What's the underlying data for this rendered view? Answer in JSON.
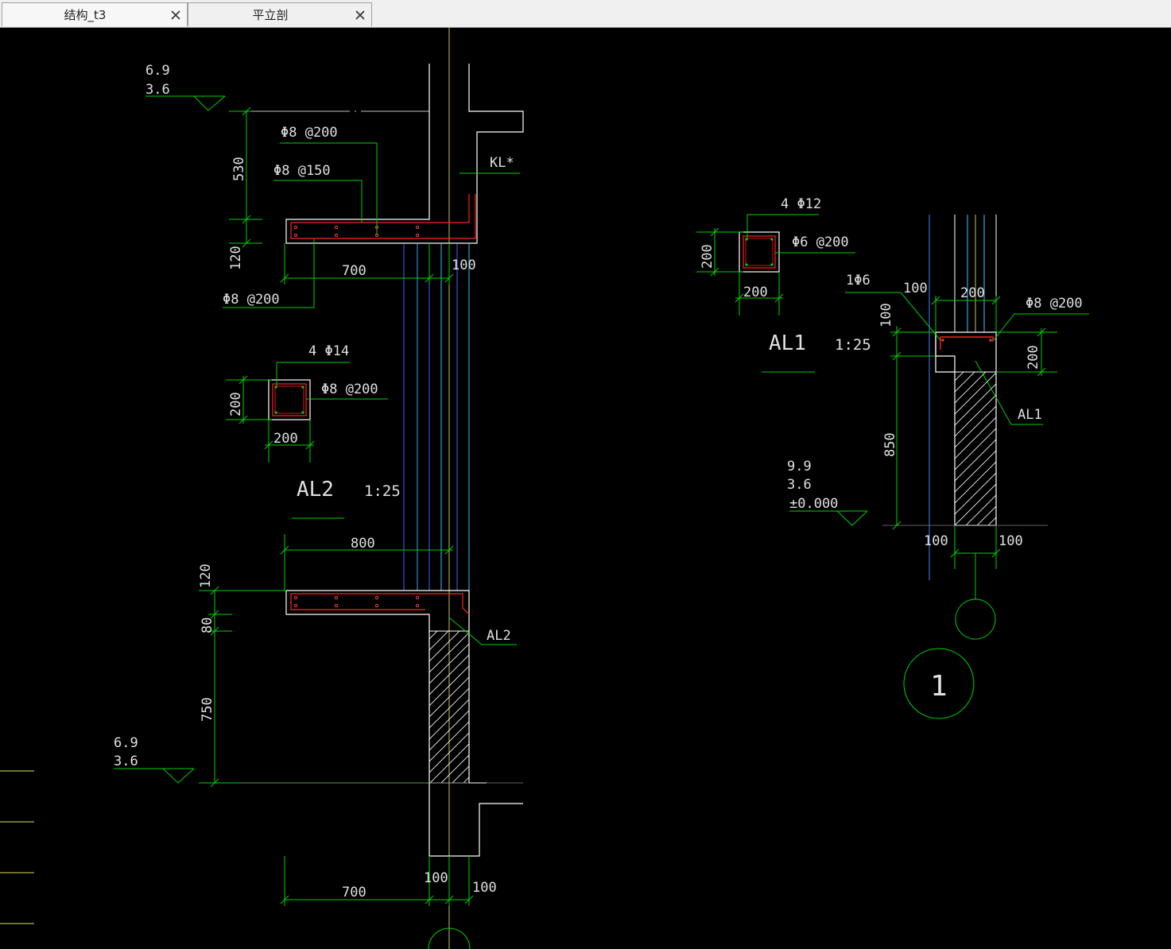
{
  "tabs": [
    {
      "label": "结构_t3",
      "active": true
    },
    {
      "label": "平立剖",
      "active": false
    }
  ],
  "colors": {
    "background": "#000000",
    "dim": "#00d000",
    "text": "#e0e0e0",
    "outline": "#ffffff",
    "rebar": "#ff2020",
    "axis": "#c8c060",
    "window_blue": "#4060ff",
    "window_cyan": "#40c0ff"
  },
  "drawing": {
    "top_level": {
      "a": "6.9",
      "b": "3.6"
    },
    "bottom_level": {
      "a": "6.9",
      "b": "3.6"
    },
    "kl_tag": "KL*",
    "rebar_top1": "Φ8 @200",
    "rebar_top2": "Φ8 @150",
    "rebar_bottom": "Φ8 @200",
    "dim_530": "530",
    "dim_120a": "120",
    "dim_700a": "700",
    "dim_100a": "100",
    "al2_section": {
      "main_bars": "4 Φ14",
      "stirrup": "Φ8 @200",
      "width": "200",
      "height": "200",
      "name": "AL2",
      "scale": "1:25"
    },
    "dim_800": "800",
    "dim_120b": "120",
    "dim_80": "80",
    "dim_750": "750",
    "al2_tag": "AL2",
    "dim_700b": "700",
    "dim_100b": "100",
    "dim_100c": "100",
    "al1_section": {
      "main_bars": "4 Φ12",
      "stirrup": "Φ6 @200",
      "width": "200",
      "height": "200",
      "name": "AL1",
      "scale": "1:25"
    },
    "detail": {
      "one_phi6": "1Φ6",
      "dim_100_top": "100",
      "dim_200_top": "200",
      "stirrup": "Φ8 @200",
      "dim_100_v": "100",
      "dim_200_v": "200",
      "al1_tag": "AL1",
      "dim_850": "850",
      "level_a": "9.9",
      "level_b": "3.6",
      "level_c": "±0.000",
      "dim_100_left": "100",
      "dim_100_right": "100",
      "detail_no": "1"
    }
  }
}
